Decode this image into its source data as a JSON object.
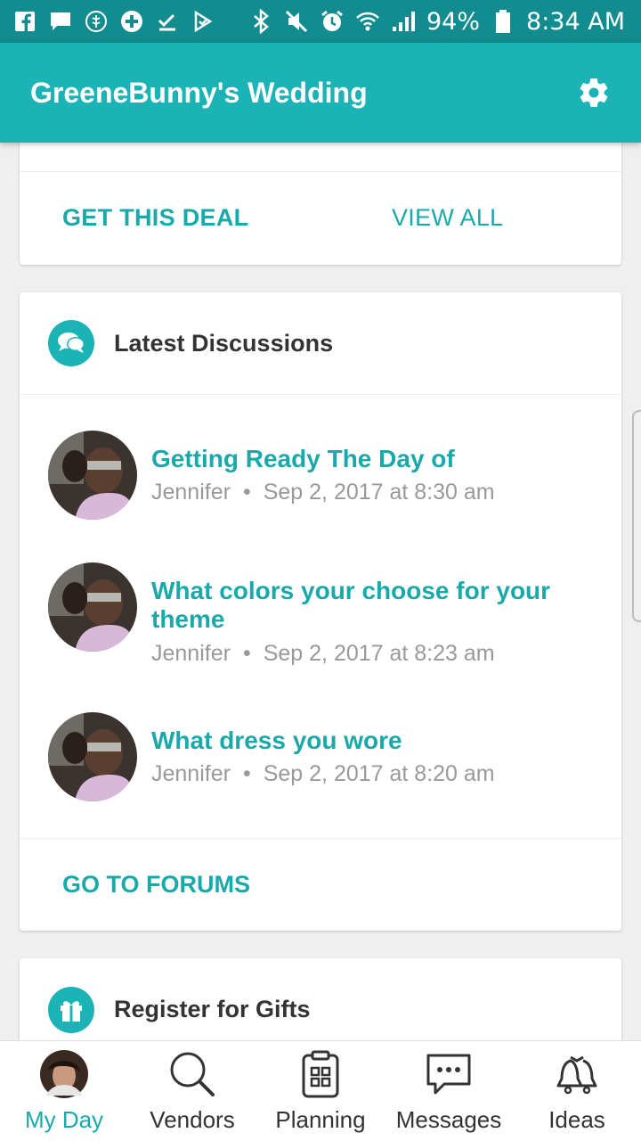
{
  "status_bar": {
    "battery": "94%",
    "time": "8:34 AM"
  },
  "app_bar": {
    "title": "GreeneBunny's Wedding",
    "settings_icon": "gear-icon"
  },
  "deal_card": {
    "get_deal_label": "GET THIS DEAL",
    "view_all_label": "VIEW ALL"
  },
  "discussions_card": {
    "title": "Latest Discussions",
    "icon": "chat-bubbles-icon",
    "items": [
      {
        "title": "Getting Ready The Day of",
        "author": "Jennifer",
        "timestamp": "Sep 2, 2017 at 8:30 am"
      },
      {
        "title": "What colors your choose for your theme",
        "author": "Jennifer",
        "timestamp": "Sep 2, 2017 at 8:23 am"
      },
      {
        "title": "What dress you wore",
        "author": "Jennifer",
        "timestamp": "Sep 2, 2017 at 8:20 am"
      }
    ],
    "footer_link": "GO TO FORUMS",
    "separator": "•"
  },
  "gifts_card": {
    "title": "Register for Gifts",
    "icon": "gift-icon"
  },
  "tab_bar": {
    "tabs": [
      {
        "label": "My Day",
        "icon": "avatar-icon",
        "active": true
      },
      {
        "label": "Vendors",
        "icon": "search-icon",
        "active": false
      },
      {
        "label": "Planning",
        "icon": "clipboard-icon",
        "active": false
      },
      {
        "label": "Messages",
        "icon": "message-icon",
        "active": false
      },
      {
        "label": "Ideas",
        "icon": "bells-icon",
        "active": false
      }
    ]
  },
  "colors": {
    "status_bar": "#128c8e",
    "app_bar": "#1bb3b5",
    "accent_text": "#1aa9ab"
  }
}
